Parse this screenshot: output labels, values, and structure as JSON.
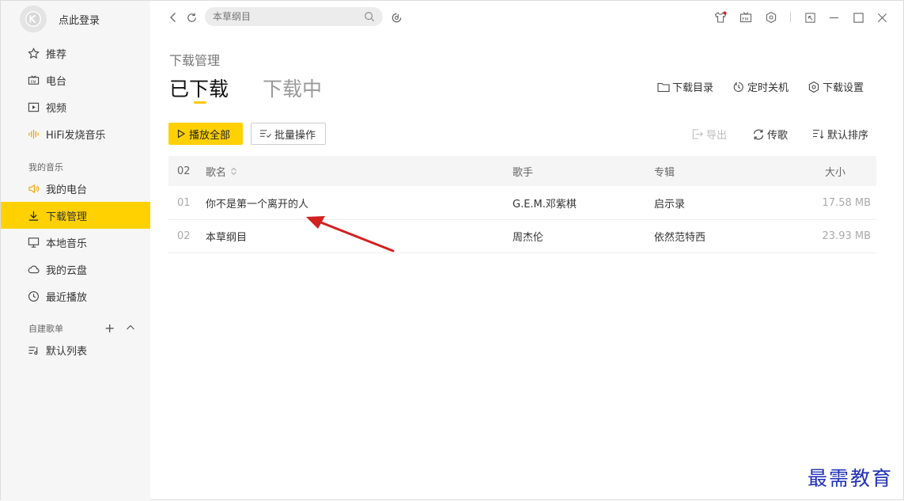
{
  "sidebar": {
    "login_label": "点此登录",
    "nav": [
      {
        "label": "推荐",
        "icon": "star-icon"
      },
      {
        "label": "电台",
        "icon": "radio-icon"
      },
      {
        "label": "视频",
        "icon": "video-icon"
      },
      {
        "label": "HiFi发烧音乐",
        "icon": "waveform-icon"
      }
    ],
    "my_music_label": "我的音乐",
    "my_music": [
      {
        "label": "我的电台",
        "icon": "speaker-icon"
      },
      {
        "label": "下载管理",
        "icon": "download-icon",
        "active": true
      },
      {
        "label": "本地音乐",
        "icon": "monitor-icon"
      },
      {
        "label": "我的云盘",
        "icon": "cloud-icon"
      },
      {
        "label": "最近播放",
        "icon": "clock-icon"
      }
    ],
    "playlist_label": "自建歌单",
    "playlists": [
      {
        "label": "默认列表",
        "icon": "playlist-icon"
      }
    ]
  },
  "search": {
    "placeholder": "本草纲目"
  },
  "main": {
    "title": "下载管理",
    "tabs": [
      {
        "label": "已下载",
        "active": true
      },
      {
        "label": "下载中",
        "active": false
      }
    ],
    "top_actions": {
      "download_dir": "下载目录",
      "timer_shutdown": "定时关机",
      "download_settings": "下载设置"
    },
    "buttons": {
      "play_all": "播放全部",
      "batch": "批量操作"
    },
    "tools": {
      "export": "导出",
      "transfer": "传歌",
      "sort": "默认排序"
    },
    "table": {
      "count": "02",
      "columns": [
        "歌名",
        "歌手",
        "专辑",
        "大小"
      ],
      "rows": [
        {
          "num": "01",
          "title": "你不是第一个离开的人",
          "artist": "G.E.M.邓紫棋",
          "album": "启示录",
          "size": "17.58 MB"
        },
        {
          "num": "02",
          "title": "本草纲目",
          "artist": "周杰伦",
          "album": "依然范特西",
          "size": "23.93 MB"
        }
      ]
    }
  },
  "watermark": "最需教育",
  "colors": {
    "accent": "#ffd100",
    "arrow": "#d32020",
    "watermark": "#1f2fb8"
  }
}
